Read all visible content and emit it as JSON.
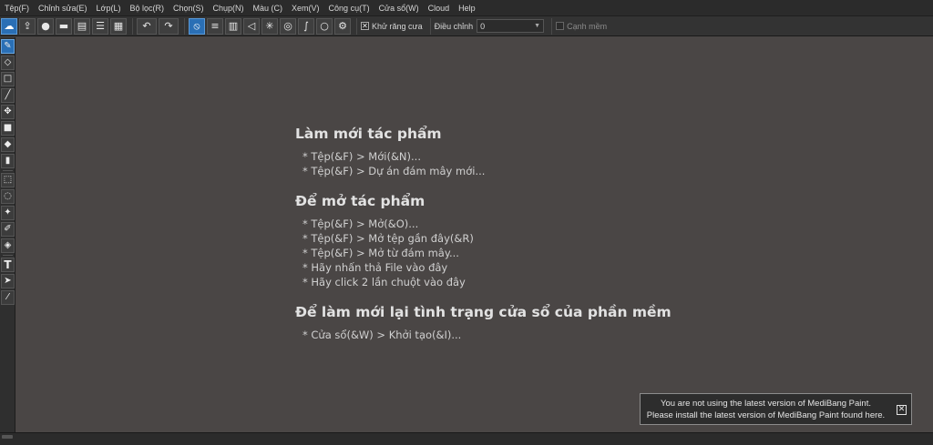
{
  "menu": [
    "Tệp(F)",
    "Chỉnh sửa(E)",
    "Lớp(L)",
    "Bộ lọc(R)",
    "Chọn(S)",
    "Chụp(N)",
    "Màu (C)",
    "Xem(V)",
    "Công cụ(T)",
    "Cửa sổ(W)",
    "Cloud",
    "Help"
  ],
  "toolbar": {
    "antialias_label": "Khử răng cưa",
    "antialias_checked": true,
    "correction_label": "Điều chỉnh",
    "correction_value": "0",
    "soft_edge_label": "Cạnh mềm",
    "soft_edge_checked": false
  },
  "help": {
    "sections": [
      {
        "heading": "Làm mới tác phẩm",
        "items": [
          "* Tệp(&F) > Mới(&N)...",
          "* Tệp(&F) > Dự án đám mây mới..."
        ]
      },
      {
        "heading": "Để mở tác phẩm",
        "items": [
          "* Tệp(&F) > Mở(&O)...",
          "* Tệp(&F) > Mở tệp gần đây(&R)",
          "* Tệp(&F) > Mở từ đám mây...",
          "* Hãy nhấn thả File vào đây",
          "* Hãy click 2 lần chuột vào đây"
        ]
      },
      {
        "heading": "Để làm mới lại tình trạng cửa sổ của phần mềm",
        "items": [
          "* Cửa sổ(&W) > Khởi tạo(&I)..."
        ]
      }
    ]
  },
  "notice": {
    "line1": "You are not using the latest version of MediBang Paint.",
    "line2": "Please install the latest version of MediBang Paint found here.",
    "close_glyph": "✕"
  },
  "colors": {
    "canvas_bg": "#4a4645",
    "accent_blue": "#2a6fb5"
  }
}
